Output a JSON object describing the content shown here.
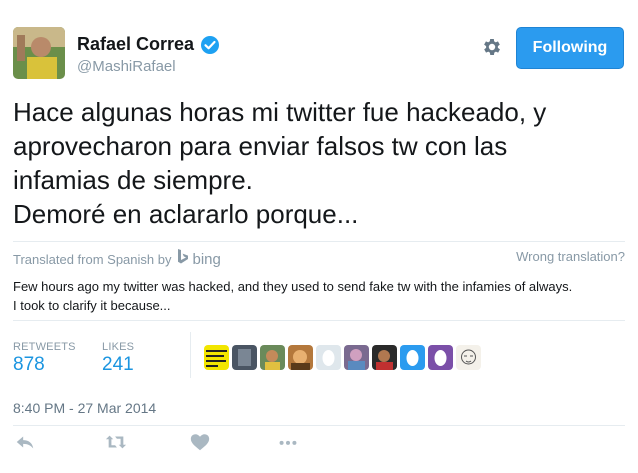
{
  "user": {
    "name": "Rafael Correa",
    "handle": "@MashiRafael"
  },
  "follow_button": {
    "label": "Following"
  },
  "tweet": {
    "lines": [
      "Hace algunas horas mi twitter fue hackeado, y",
      "aprovecharon para enviar falsos tw con las",
      "infamias de siempre.",
      "Demoré en aclararlo porque..."
    ]
  },
  "translation": {
    "label": "Translated from Spanish by",
    "provider": "bing",
    "wrong_link": "Wrong translation?",
    "lines": [
      "Few hours ago my twitter was hacked, and they used to send fake tw with the infamies of always.",
      "I took to clarify it because..."
    ]
  },
  "stats": {
    "retweets_label": "RETWEETS",
    "retweets_value": "878",
    "likes_label": "LIKES",
    "likes_value": "241"
  },
  "timestamp": "8:40 PM - 27 Mar 2014",
  "colors": {
    "accent": "#1b95e0",
    "follow_button": "#2b9bef",
    "muted": "#8899a6"
  },
  "icons": [
    "verified-badge-icon",
    "gear-icon",
    "bing-logo-icon",
    "reply-icon",
    "retweet-icon",
    "like-icon",
    "more-icon"
  ]
}
